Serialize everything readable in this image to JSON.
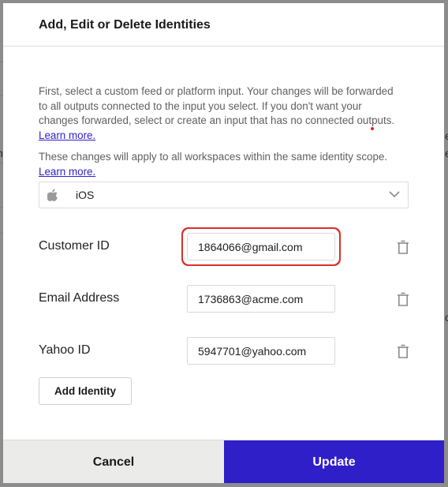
{
  "modal": {
    "title": "Add, Edit or Delete Identities",
    "description_1": "First, select a custom feed or platform input. Your changes will be forwarded to all outputs connected to the input you select. If you don't want your changes forwarded, select or create an input that has no connected outputs.",
    "learn_more_1": "Learn more.",
    "description_2": "These changes will apply to all workspaces within the same identity scope.",
    "learn_more_2": "Learn more.",
    "platform_select": {
      "icon": "apple-icon",
      "value": "iOS"
    },
    "identities": [
      {
        "label": "Customer ID",
        "value": "1864066@gmail.com",
        "highlighted": true
      },
      {
        "label": "Email Address",
        "value": "1736863@acme.com"
      },
      {
        "label": "Yahoo ID",
        "value": "5947701@yahoo.com"
      }
    ],
    "add_identity_label": "Add Identity",
    "cancel_label": "Cancel",
    "update_label": "Update"
  },
  "colors": {
    "accent": "#2f1fc9",
    "highlight_ring": "#d9302a",
    "cancel_bg": "#ebebea"
  },
  "background_fragments": {
    "left": "n",
    "right_1": "e",
    "right_2": "e",
    "right_3": "c"
  }
}
